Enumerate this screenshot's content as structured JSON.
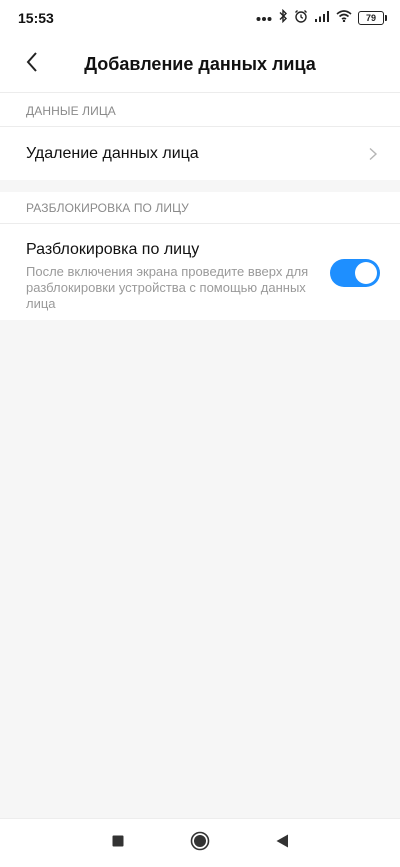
{
  "status_bar": {
    "time": "15:53",
    "battery": "79",
    "icons": [
      "dots-icon",
      "bluetooth-icon",
      "alarm-icon",
      "signal-icon",
      "wifi-icon",
      "battery-icon"
    ]
  },
  "header": {
    "title": "Добавление данных лица",
    "back_icon": "back-arrow-icon"
  },
  "sections": {
    "face_data": {
      "label": "ДАННЫЕ ЛИЦА",
      "delete_row": {
        "title": "Удаление данных лица",
        "icon": "chevron-right-icon"
      }
    },
    "face_unlock": {
      "label": "РАЗБЛОКИРОВКА ПО ЛИЦУ",
      "toggle_row": {
        "title": "Разблокировка по лицу",
        "description": "После включения экрана проведите вверх для разблокировки устройства с помощью данных лица",
        "enabled": true
      }
    }
  },
  "colors": {
    "accent": "#1e8fff",
    "background": "#f6f6f6",
    "card": "#ffffff",
    "secondary_text": "#8a8a8a"
  },
  "nav_bar": {
    "icons": [
      "square-icon",
      "circle-icon",
      "triangle-back-icon"
    ]
  }
}
